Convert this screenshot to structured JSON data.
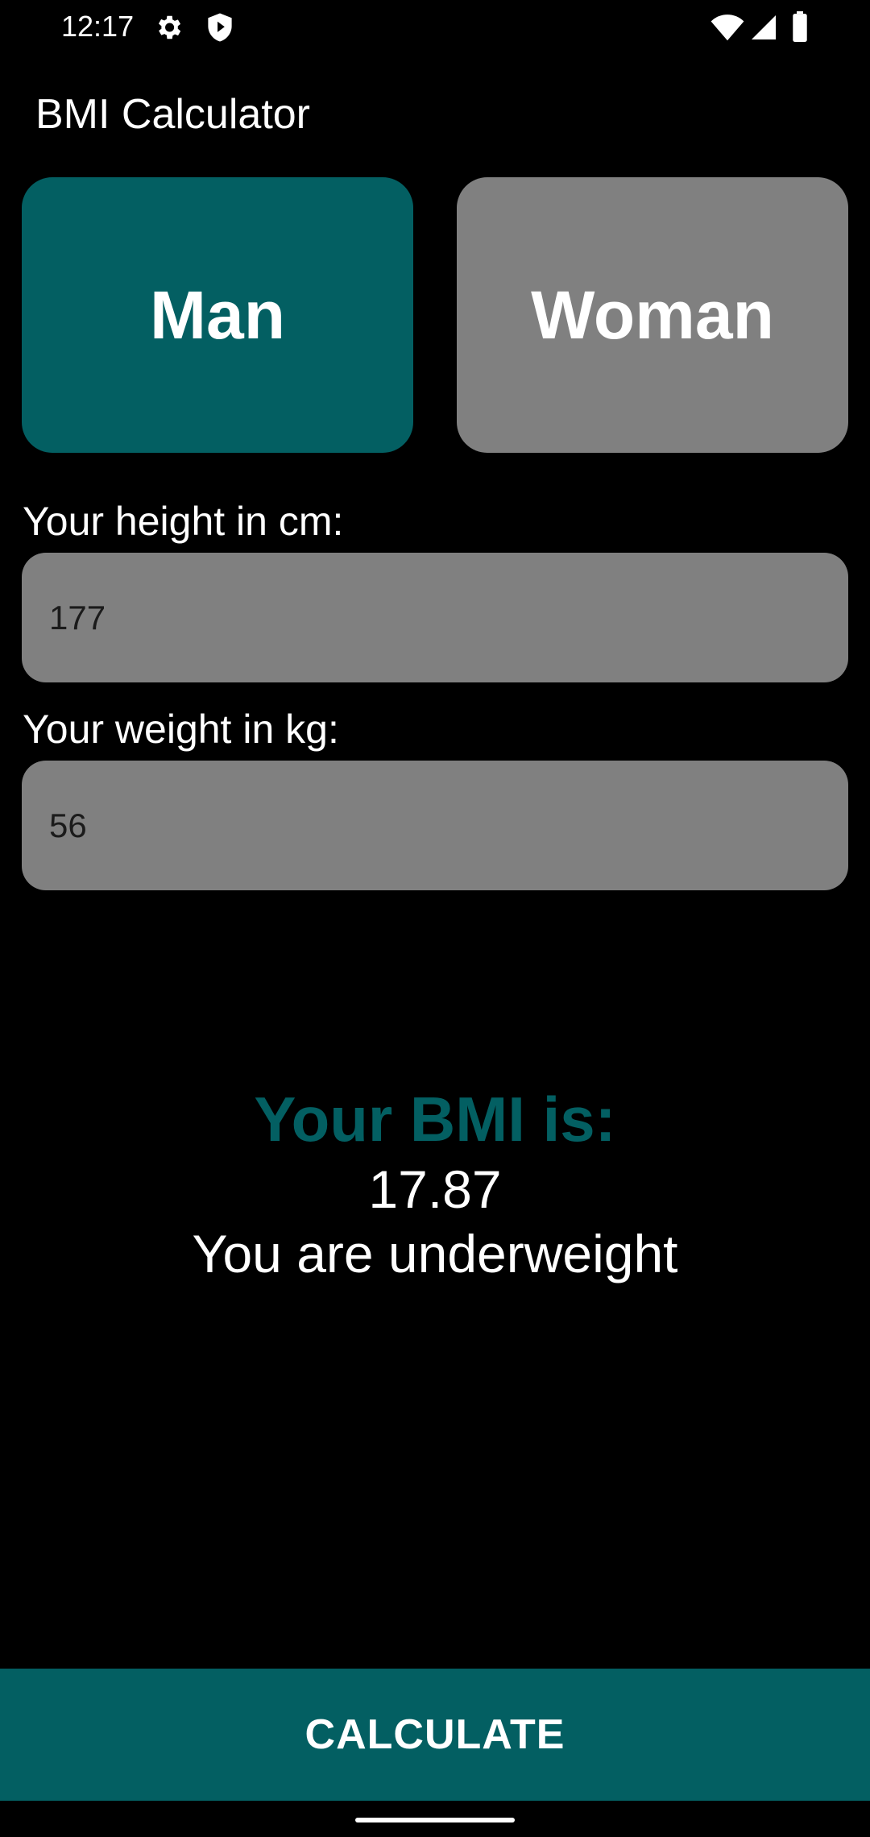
{
  "status_bar": {
    "time": "12:17",
    "icons": [
      "gear-icon",
      "shield-icon",
      "wifi-icon",
      "signal-icon",
      "battery-icon"
    ]
  },
  "app_bar": {
    "title": "BMI Calculator"
  },
  "gender": {
    "options": [
      {
        "label": "Man",
        "selected": true
      },
      {
        "label": "Woman",
        "selected": false
      }
    ]
  },
  "form": {
    "height_label": "Your height in cm:",
    "height_value": "177",
    "weight_label": "Your weight in kg:",
    "weight_value": "56"
  },
  "result": {
    "heading": "Your BMI is:",
    "value": "17.87",
    "category": "You are underweight"
  },
  "actions": {
    "calculate_label": "CALCULATE"
  },
  "colors": {
    "accent": "#035f62",
    "field_bg": "#808080",
    "background": "#000000",
    "text": "#ffffff"
  }
}
